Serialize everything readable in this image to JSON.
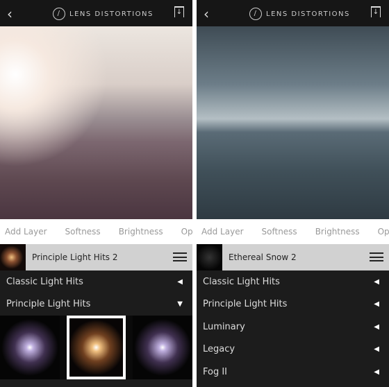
{
  "header": {
    "title": "LENS DISTORTIONS",
    "back_icon": "chevron-left-icon",
    "logo_icon": "lens-logo-icon",
    "download_icon": "download-icon"
  },
  "tabs": [
    "Add Layer",
    "Softness",
    "Brightness",
    "Opacity"
  ],
  "left": {
    "selected": "Principle Light Hits 2",
    "categories": [
      {
        "label": "Classic Light Hits",
        "state": "collapsed"
      },
      {
        "label": "Principle Light Hits",
        "state": "expanded"
      }
    ],
    "thumbnails": 3,
    "selected_thumbnail": 2
  },
  "right": {
    "selected": "Ethereal Snow 2",
    "categories": [
      {
        "label": "Classic Light Hits"
      },
      {
        "label": "Principle Light Hits"
      },
      {
        "label": "Luminary"
      },
      {
        "label": "Legacy"
      },
      {
        "label": "Fog II"
      }
    ]
  }
}
